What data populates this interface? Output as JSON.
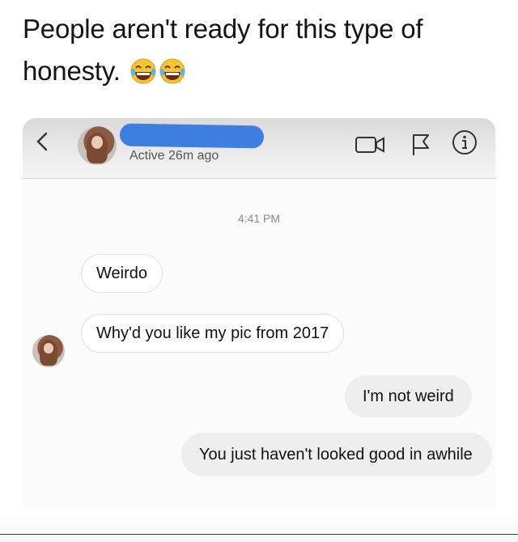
{
  "post": {
    "caption": "People aren't ready for this type of honesty.",
    "caption_line1": "People aren't ready for this type of",
    "caption_line2": "honesty."
  },
  "chat": {
    "header": {
      "status": "Active 26m ago",
      "icons": [
        "back-chevron-icon",
        "video-call-icon",
        "flag-icon",
        "info-icon"
      ]
    },
    "timestamp": "4:41 PM",
    "messages": [
      {
        "side": "received",
        "text": "Weirdo"
      },
      {
        "side": "received",
        "text": "Why'd you like my pic from 2017"
      },
      {
        "side": "sent",
        "text": "I'm not weird"
      },
      {
        "side": "sent",
        "text": "You just haven't looked good in awhile"
      }
    ]
  },
  "colors": {
    "redaction": "#3d7fe0",
    "received_bubble": "#ffffff",
    "sent_bubble": "#eeeeee",
    "header_bg": "#e4e4e4"
  }
}
